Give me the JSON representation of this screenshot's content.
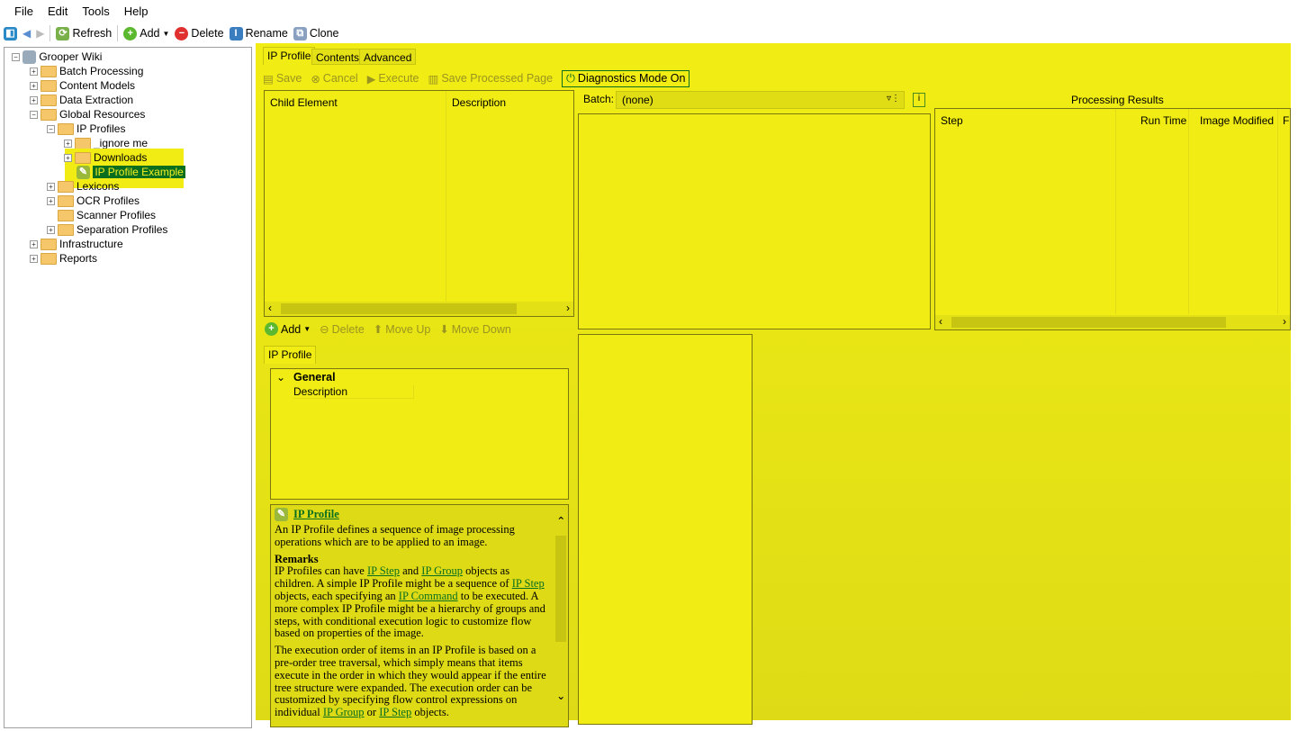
{
  "menu": [
    "File",
    "Edit",
    "Tools",
    "Help"
  ],
  "toolbar": {
    "refresh": "Refresh",
    "add": "Add",
    "delete": "Delete",
    "rename": "Rename",
    "clone": "Clone"
  },
  "tree": {
    "root": "Grooper Wiki",
    "items": [
      "Batch Processing",
      "Content Models",
      "Data Extraction",
      "Global Resources",
      "IP Profiles",
      "_ignore me",
      "Downloads",
      "IP Profile Example",
      "Lexicons",
      "OCR Profiles",
      "Scanner Profiles",
      "Separation Profiles",
      "Infrastructure",
      "Reports"
    ]
  },
  "tabs": [
    "IP Profile",
    "Contents",
    "Advanced"
  ],
  "actions": {
    "save": "Save",
    "cancel": "Cancel",
    "execute": "Execute",
    "save_page": "Save Processed Page",
    "diagnostics": "Diagnostics Mode On"
  },
  "child_grid": {
    "columns": [
      "Child Element",
      "Description"
    ]
  },
  "child_actions": {
    "add": "Add",
    "delete": "Delete",
    "move_up": "Move Up",
    "move_down": "Move Down"
  },
  "batch": {
    "label": "Batch:",
    "value": "(none)"
  },
  "results": {
    "title": "Processing Results",
    "columns": [
      "Step",
      "Run Time",
      "Image Modified",
      "F"
    ]
  },
  "props": {
    "tab": "IP Profile",
    "category": "General",
    "field": "Description"
  },
  "help": {
    "title": "IP Profile",
    "intro": "An IP Profile defines a sequence of image processing operations which are to be applied to an image.",
    "remarks_heading": "Remarks",
    "p1a": "IP Profiles can have ",
    "l1": "IP Step",
    "p1b": " and ",
    "l2": "IP Group",
    "p1c": " objects as children. A simple IP Profile might be a sequence of ",
    "l3": "IP Step",
    "p1d": " objects, each specifying an ",
    "l4": "IP Command",
    "p1e": " to be executed. A more complex IP Profile might be a hierarchy of groups and steps, with conditional execution logic to customize flow based on properties of the image.",
    "p2a": "The execution order of items in an IP Profile is based on a pre-order tree traversal, which simply means that items execute in the order in which they would appear if the entire tree structure were expanded. The execution order can be customized by specifying flow control expressions on individual ",
    "l5": "IP Group",
    "p2b": " or ",
    "l6": "IP Step",
    "p2c": " objects."
  },
  "colors": {
    "highlight": "#f0ec14",
    "selected": "#0a6e1f"
  }
}
